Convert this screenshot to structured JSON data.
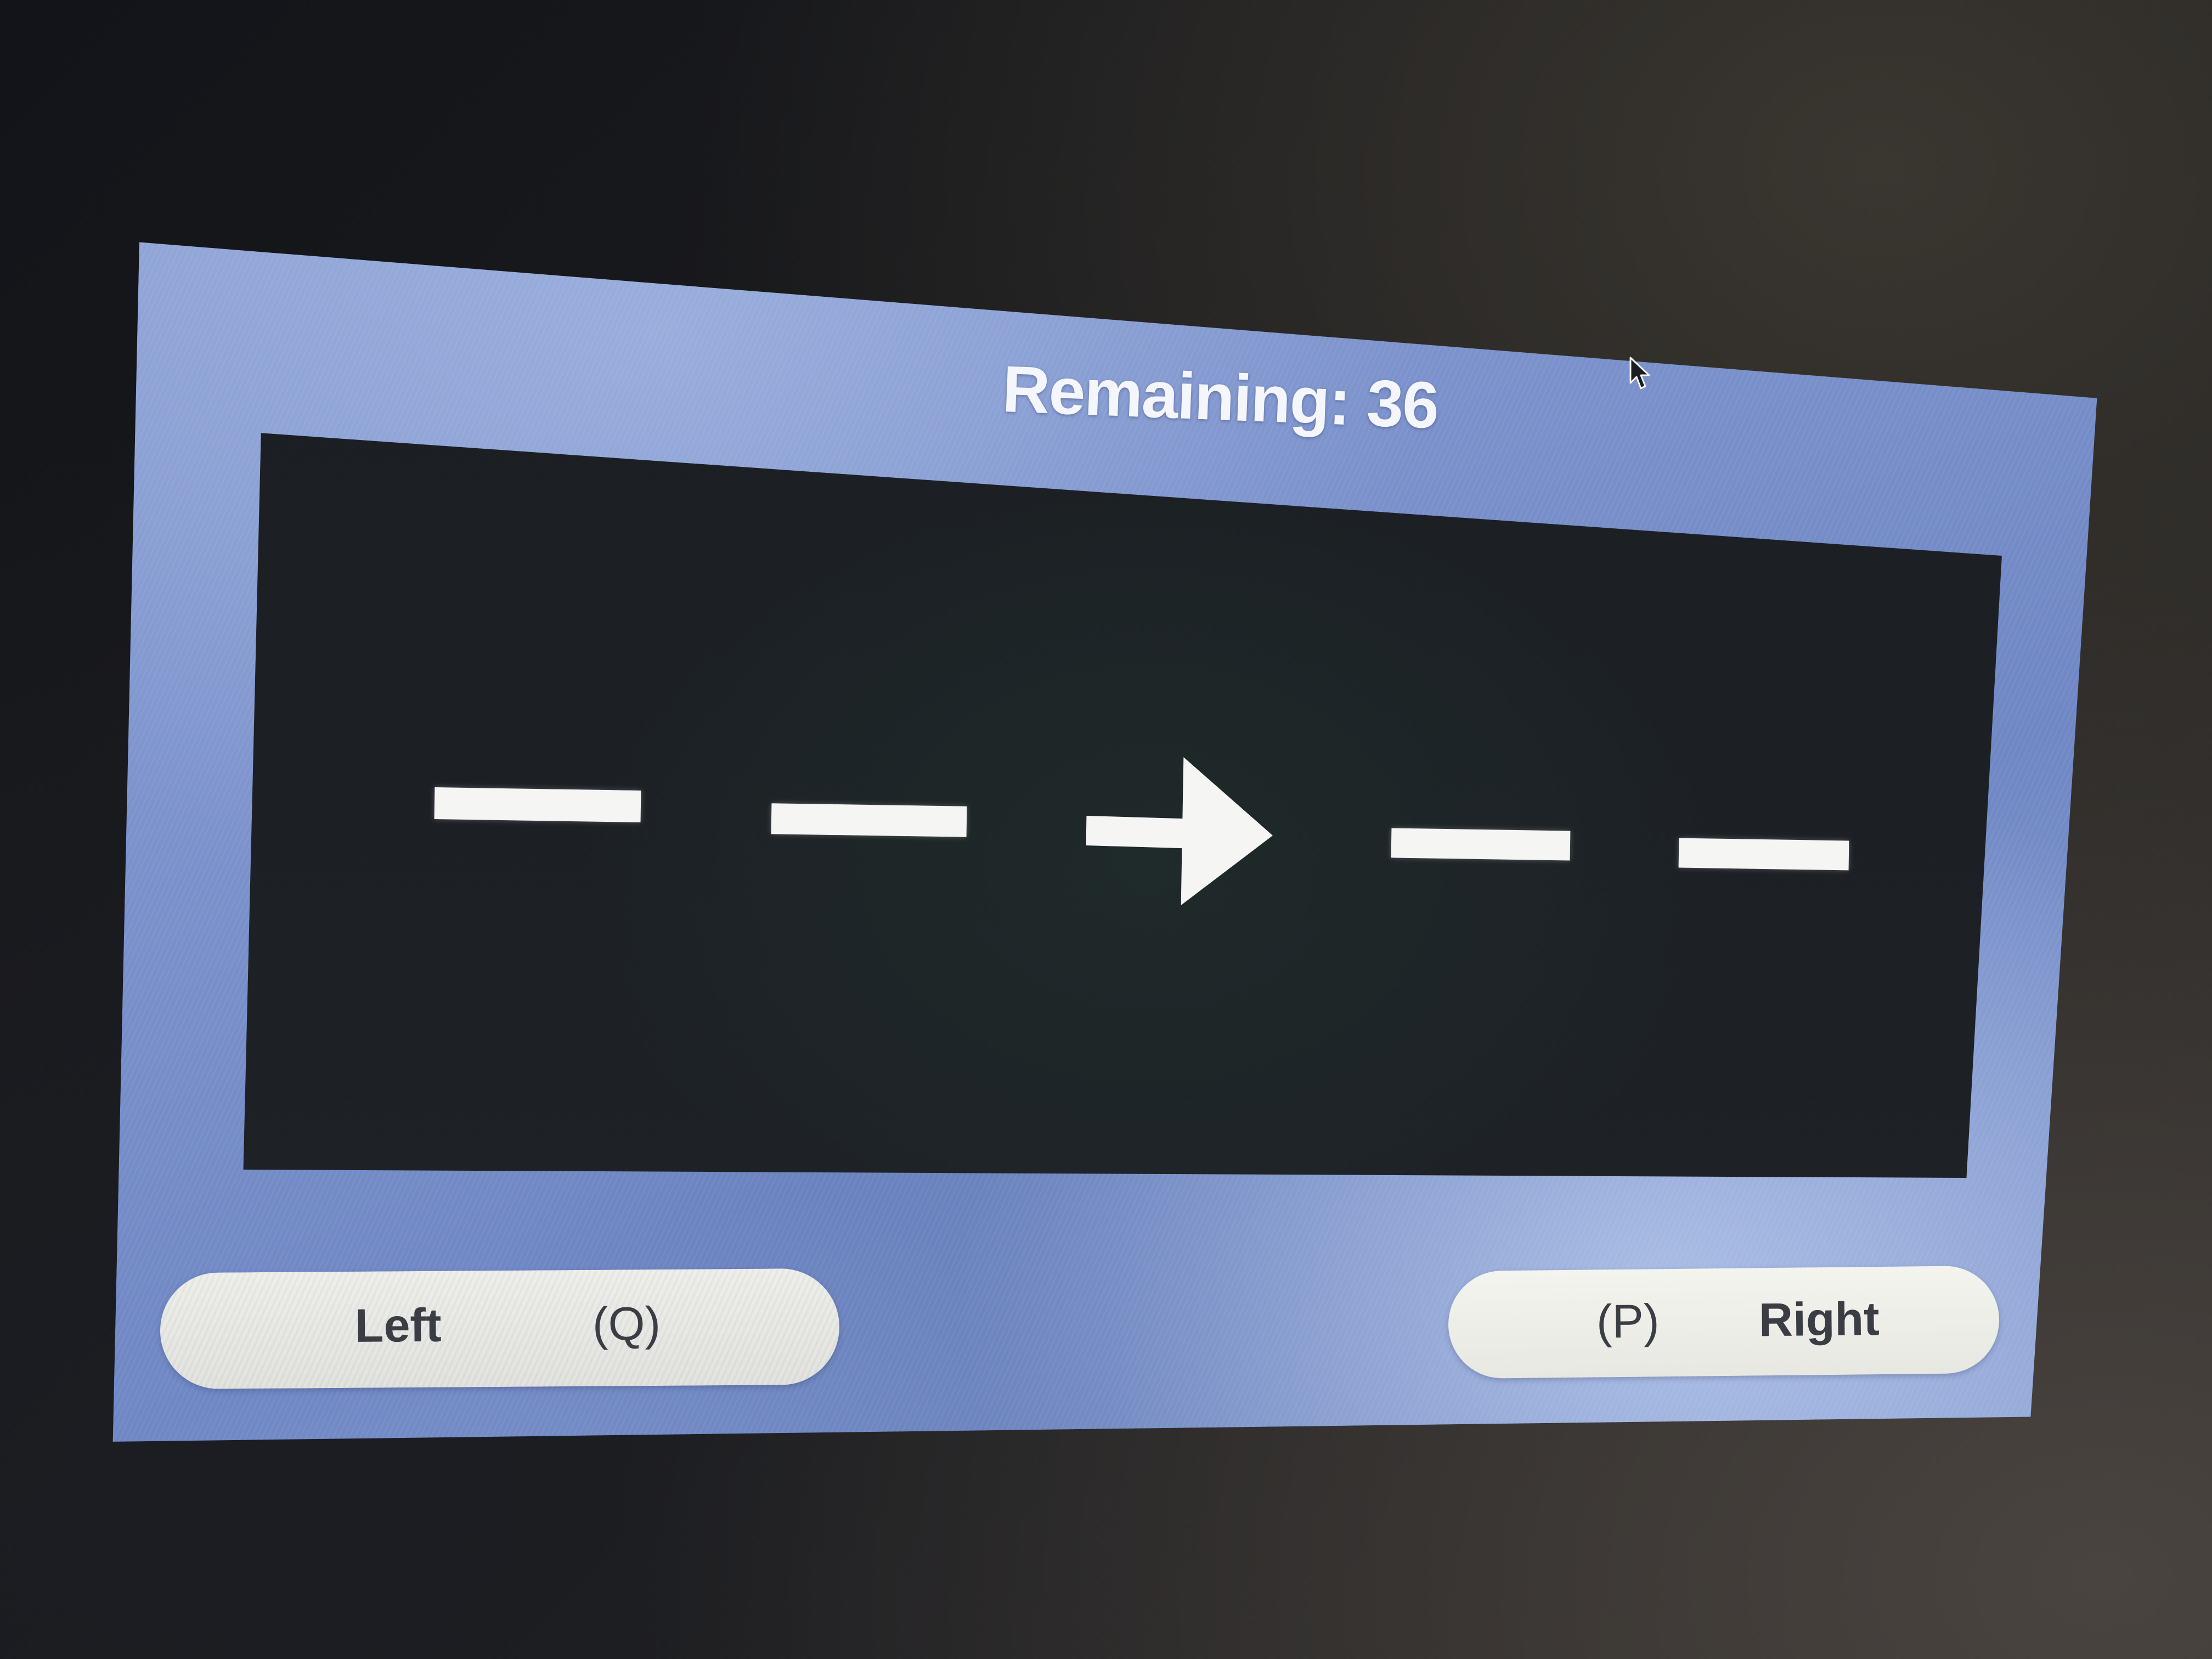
{
  "status": {
    "remaining_text": "Remaining: 36"
  },
  "stimulus": {
    "items": [
      "dash",
      "dash",
      "arrow-right",
      "dash",
      "dash"
    ],
    "target_direction": "right",
    "color": "#f5f5f3"
  },
  "buttons": {
    "left": {
      "label": "Left",
      "key": "(Q)"
    },
    "right": {
      "label": "Right",
      "key": "(P)"
    }
  },
  "colors": {
    "panel_blue": "#7c92cc",
    "stimulus_bg": "#1c1f24",
    "button_bg": "#eeeeea"
  }
}
